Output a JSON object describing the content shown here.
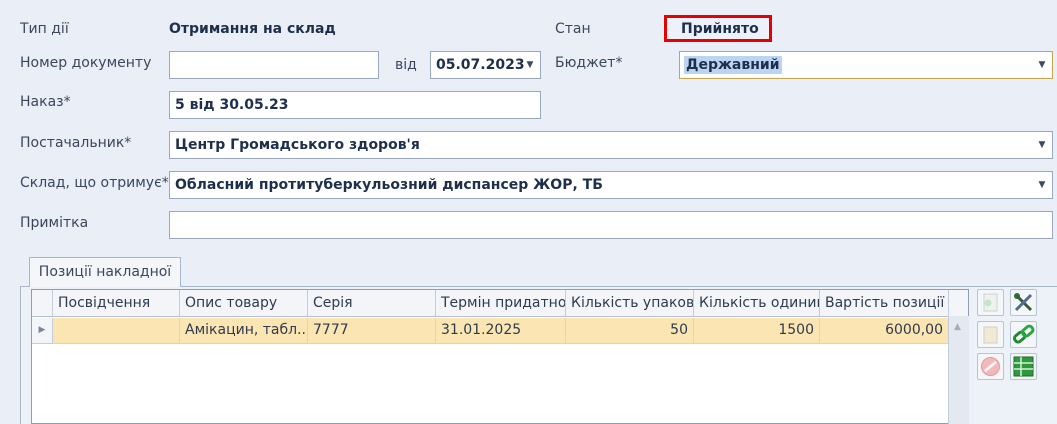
{
  "form": {
    "type_label": "Тип дії",
    "type_value": "Отримання на склад",
    "status_label": "Стан",
    "status_value": "Прийнято",
    "doc_number_label": "Номер документу",
    "doc_number_value": "",
    "date_from_label": "від",
    "date_value": "05.07.2023",
    "budget_label": "Бюджет*",
    "budget_value": "Державний",
    "order_label": "Наказ*",
    "order_value": "5 від 30.05.23",
    "supplier_label": "Постачальник*",
    "supplier_value": "Центр Громадського здоров'я",
    "warehouse_label": "Склад, що отримує*",
    "warehouse_value": "Обласний протитуберкульозний диспансер ЖОР, ТБ",
    "note_label": "Примітка",
    "note_value": ""
  },
  "tabs": {
    "positions_label": "Позиції накладної"
  },
  "grid": {
    "columns": [
      "Посвідчення",
      "Опис товару",
      "Серія",
      "Термін придатно",
      "Кількість упаковс",
      "Кількість одиниц",
      "Вартість позиції"
    ],
    "rows": [
      {
        "certificate": "",
        "description": "Амікацин, табл...",
        "series": "7777",
        "expiry": "31.01.2025",
        "packages": "50",
        "units": "1500",
        "cost": "6000,00"
      }
    ]
  },
  "toolbar": {
    "icons": [
      "add-icon",
      "settings-tools-icon",
      "edit-icon",
      "link-icon",
      "delete-icon",
      "table-icon"
    ]
  },
  "colors": {
    "status_border": "#e60000",
    "row_highlight": "#fbe5b3",
    "selection": "#bcd4f2"
  }
}
